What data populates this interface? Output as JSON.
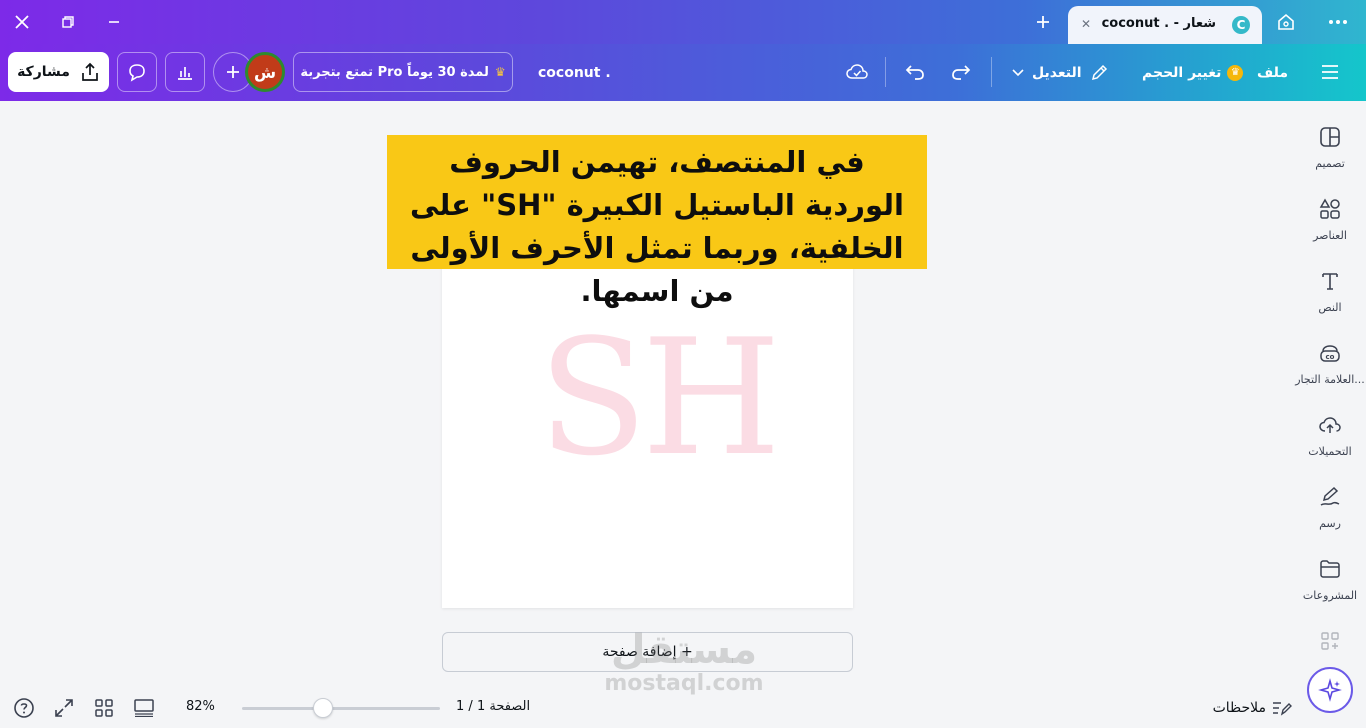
{
  "titlebar": {
    "tab_title": "coconut . - شعار",
    "tab_logo": "C",
    "close_icon": "close-icon",
    "restore_icon": "restore-icon",
    "minimize_icon": "minimize-icon"
  },
  "toolbar": {
    "share_label": "مشاركة",
    "pro_label": "تمتع بتجربة Pro لمدة 30 يوماً",
    "design_name": "coconut .",
    "edit_label": "التعديل",
    "resize_label": "تغيير الحجم",
    "file_label": "ملف",
    "avatar_letter": "ش"
  },
  "sidebar": {
    "items": [
      {
        "label": "تصميم",
        "icon": "design-icon"
      },
      {
        "label": "العناصر",
        "icon": "elements-icon"
      },
      {
        "label": "النص",
        "icon": "text-icon"
      },
      {
        "label": "العلامة التجار...",
        "icon": "brand-icon"
      },
      {
        "label": "التحميلات",
        "icon": "uploads-icon"
      },
      {
        "label": "رسم",
        "icon": "draw-icon"
      },
      {
        "label": "المشروعات",
        "icon": "projects-icon"
      }
    ]
  },
  "canvas": {
    "logo_text": "SH",
    "caption": "في المنتصف، تهيمن الحروف الوردية الباستيل الكبيرة \"SH\" على الخلفية، وربما تمثل الأحرف الأولى من اسمها.",
    "add_page_label": "+ إضافة صفحة"
  },
  "footer": {
    "zoom": "82%",
    "zoom_fraction": 0.41,
    "page_indicator": "الصفحة 1 / 1",
    "notes_label": "ملاحظات"
  },
  "watermark": {
    "line1": "مستقل",
    "line2": "mostaql.com"
  },
  "colors": {
    "caption_bg": "#f9c816",
    "logo_pink": "#fbdce4",
    "share_bg": "#ffffff"
  }
}
